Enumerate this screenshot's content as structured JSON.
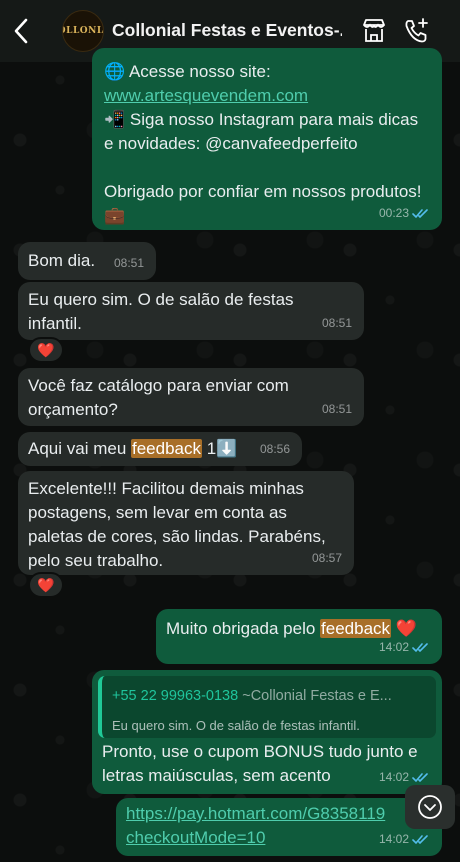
{
  "header": {
    "title": "Collonial Festas e Eventos-...",
    "avatar_text": "COLLONIAL",
    "back_icon": "chevron-left-icon",
    "shop_icon": "storefront-icon",
    "call_icon": "add-call-icon"
  },
  "messages": [
    {
      "direction": "out",
      "lines": [
        "🌐 Acesse nosso site:"
      ],
      "link": "www.artesquevendem.com",
      "text2": "📲 Siga nosso Instagram para mais dicas e novidades: @canvafeedperfeito",
      "text3": "Obrigado por confiar em nossos produtos! 💼",
      "time": "00:23",
      "status": "read"
    },
    {
      "direction": "in",
      "text": "Bom dia.",
      "time": "08:51"
    },
    {
      "direction": "in",
      "text": "Eu quero sim. O de salão de festas infantil.",
      "time": "08:51",
      "reaction": "❤️"
    },
    {
      "direction": "in",
      "text": "Você faz catálogo para enviar com orçamento?",
      "time": "08:51"
    },
    {
      "direction": "in",
      "text_before": "Aqui vai meu ",
      "highlight": "feedback",
      "text_after": " 1⬇️",
      "time": "08:56"
    },
    {
      "direction": "in",
      "text": "Excelente!!! Facilitou demais minhas postagens, sem levar em conta as paletas de cores, são lindas. Parabéns, pelo seu trabalho.",
      "time": "08:57",
      "reaction": "❤️"
    },
    {
      "direction": "out",
      "text_before": "Muito obrigada pelo ",
      "highlight": "feedback",
      "text_after": " ❤️",
      "time": "14:02",
      "status": "read"
    },
    {
      "direction": "out",
      "quote_author": "+55 22 99963-0138",
      "quote_author_name": "~Collonial Festas e E...",
      "quote_text": "Eu quero sim. O de salão de festas infantil.",
      "text": "Pronto, use o cupom BONUS tudo junto e letras maiúsculas, sem acento",
      "time": "14:02",
      "status": "read"
    },
    {
      "direction": "out",
      "link_line1": "https://pay.hotmart.com/G8358119",
      "link_line2": "checkoutMode=10",
      "time": "14:02",
      "status": "read"
    }
  ],
  "scroll_button_icon": "chevron-down-circle-icon"
}
